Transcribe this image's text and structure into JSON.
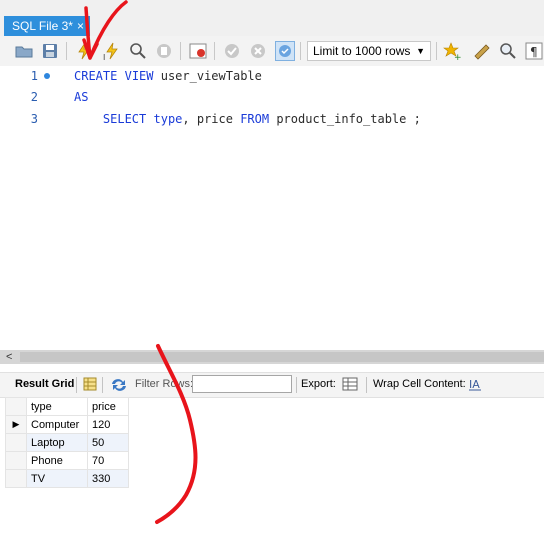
{
  "tab": {
    "title": "SQL File 3*",
    "close": "×"
  },
  "toolbar": {
    "limit_select": "Limit to 1000 rows",
    "buttons": [
      "open-folder",
      "save",
      "execute",
      "execute-current",
      "explain",
      "stop",
      "toggle-error",
      "commit",
      "rollback",
      "autocommit",
      "beautify",
      "find",
      "invisible"
    ]
  },
  "editor": {
    "lines": [
      {
        "num": "1",
        "tokens": [
          {
            "t": "CREATE",
            "k": "kw"
          },
          {
            "t": " ",
            "k": "tx"
          },
          {
            "t": "VIEW",
            "k": "kw"
          },
          {
            "t": " user_viewTable",
            "k": "tx"
          }
        ]
      },
      {
        "num": "2",
        "tokens": [
          {
            "t": "AS",
            "k": "kw"
          }
        ]
      },
      {
        "num": "3",
        "tokens": [
          {
            "t": "    ",
            "k": "tx"
          },
          {
            "t": "SELECT",
            "k": "kw"
          },
          {
            "t": " ",
            "k": "tx"
          },
          {
            "t": "type",
            "k": "kw"
          },
          {
            "t": ", price ",
            "k": "tx"
          },
          {
            "t": "FROM",
            "k": "kw"
          },
          {
            "t": " product_info_table ;",
            "k": "tx"
          }
        ]
      }
    ]
  },
  "results": {
    "result_grid_label": "Result Grid",
    "filter_label": "Filter Rows:",
    "filter_value": "",
    "export_label": "Export:",
    "wrap_label": "Wrap Cell Content:",
    "columns": [
      "type",
      "price"
    ],
    "rows": [
      [
        "Computer",
        "120"
      ],
      [
        "Laptop",
        "50"
      ],
      [
        "Phone",
        "70"
      ],
      [
        "TV",
        "330"
      ]
    ]
  },
  "scrollbar": {
    "arrow": "<"
  },
  "colors": {
    "tab_active": "#2e8fdc",
    "keyword": "#1a3bd8",
    "annotation": "#e8141b"
  }
}
